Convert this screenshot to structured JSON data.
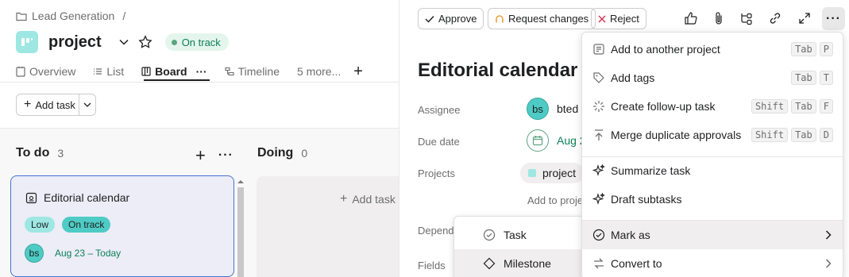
{
  "breadcrumb": {
    "label": "Lead Generation",
    "separator": "/"
  },
  "project": {
    "name": "project",
    "status": "On track"
  },
  "tabs": [
    {
      "label": "Overview"
    },
    {
      "label": "List"
    },
    {
      "label": "Board"
    },
    {
      "label": "Timeline"
    },
    {
      "label": "5 more..."
    }
  ],
  "toolbar": {
    "add_task": "Add task"
  },
  "columns": [
    {
      "title": "To do",
      "count": "3"
    },
    {
      "title": "Doing",
      "count": "0",
      "add_task": "Add task"
    }
  ],
  "card": {
    "title": "Editorial calendar",
    "tags": [
      "Low",
      "On track"
    ],
    "assignee_initials": "bs",
    "date": "Aug 23 – Today"
  },
  "task_toolbar": {
    "approve": "Approve",
    "request_changes": "Request changes",
    "reject": "Reject"
  },
  "task": {
    "title": "Editorial calendar",
    "fields": {
      "assignee_label": "Assignee",
      "assignee_initials": "bs",
      "assignee_name": "bted",
      "due_label": "Due date",
      "due_value": "Aug 2",
      "projects_label": "Projects",
      "project_name": "project",
      "add_to_project": "Add to proje",
      "dependencies_label": "Depende",
      "fields_label": "Fields"
    }
  },
  "menu": {
    "items": [
      {
        "label": "Add to another project",
        "keys": [
          "Tab",
          "P"
        ]
      },
      {
        "label": "Add tags",
        "keys": [
          "Tab",
          "T"
        ]
      },
      {
        "label": "Create follow-up task",
        "keys": [
          "Shift",
          "Tab",
          "F"
        ]
      },
      {
        "label": "Merge duplicate approvals",
        "keys": [
          "Shift",
          "Tab",
          "D"
        ]
      },
      {
        "label": "Summarize task",
        "keys": []
      },
      {
        "label": "Draft subtasks",
        "keys": []
      },
      {
        "label": "Mark as",
        "keys": []
      },
      {
        "label": "Convert to",
        "keys": []
      }
    ]
  },
  "submenu": {
    "items": [
      {
        "label": "Task"
      },
      {
        "label": "Milestone"
      }
    ]
  },
  "colors": {
    "accent": "#4573d2",
    "teal": "#4ecbc4",
    "green": "#0d7f56",
    "reject": "#d1395a",
    "request": "#e8a33d"
  }
}
